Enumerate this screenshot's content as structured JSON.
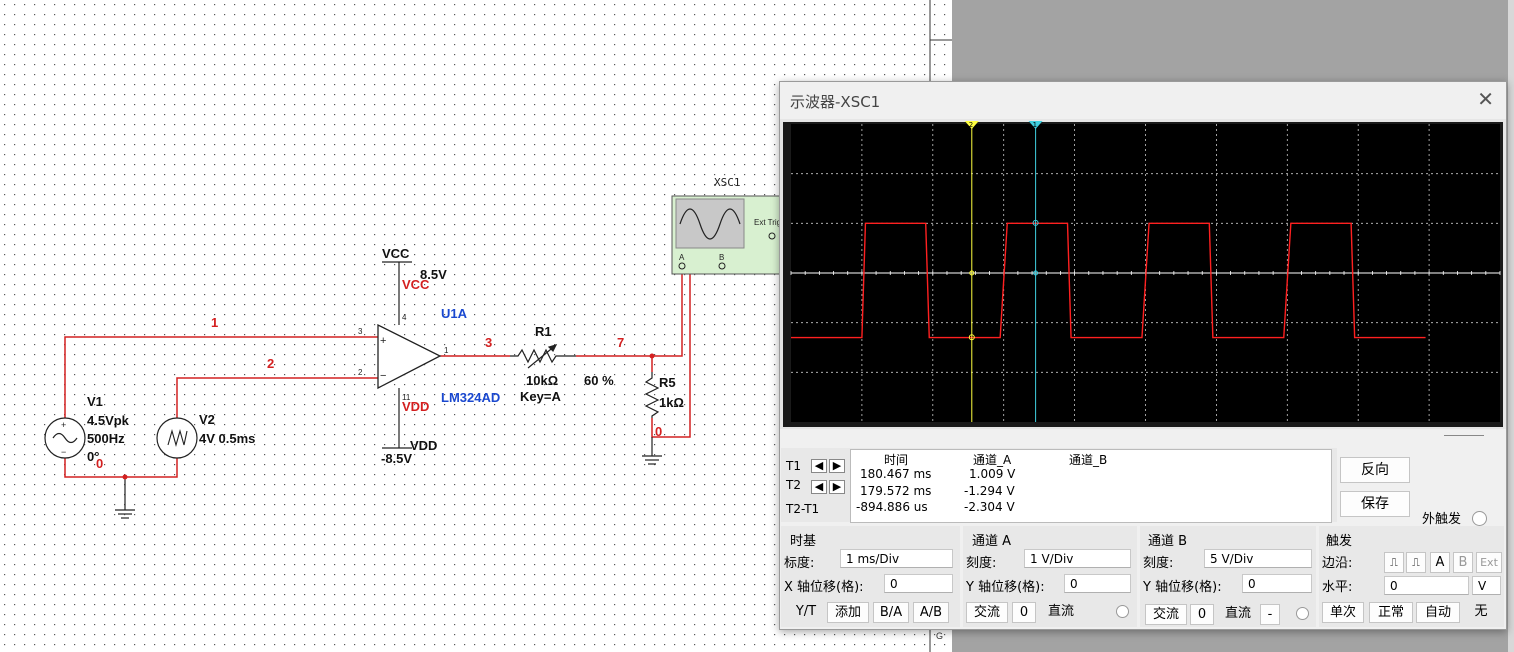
{
  "schematic": {
    "vcc_label": "VCC",
    "vcc_value": "8.5V",
    "vcc_net": "VCC",
    "vdd_label": "VDD",
    "vdd_value": "-8.5V",
    "vdd_net": "VDD",
    "opamp_ref": "U1A",
    "opamp_part": "LM324AD",
    "pin_plus": "3",
    "pin_minus": "2",
    "pin_out": "1",
    "pin_vcc": "4",
    "pin_vdd": "11",
    "plus_sign": "+",
    "minus_sign": "−",
    "net1": "1",
    "net2": "2",
    "net3": "3",
    "net7": "7",
    "net0a": "0",
    "net0b": "0",
    "v1_name": "V1",
    "v1_amp": "4.5Vpk",
    "v1_freq": "500Hz",
    "v1_phase": "0°",
    "v2_name": "V2",
    "v2_value": "4V 0.5ms",
    "r1_name": "R1",
    "r1_value": "10kΩ",
    "r1_key": "Key=A",
    "r1_percent": "60 %",
    "r5_name": "R5",
    "r5_value": "1kΩ",
    "xsc_name": "XSC1",
    "xsc_ext": "Ext Trig",
    "xsc_a": "A",
    "xsc_b": "B",
    "margin_g": "G"
  },
  "oscilloscope": {
    "title": "示波器-XSC1",
    "close_icon": "close-icon",
    "readout": {
      "col_time": "时间",
      "col_a": "通道_A",
      "col_b": "通道_B",
      "rows": [
        {
          "label": "T1",
          "time": "180.467 ms",
          "a": "1.009 V",
          "b": ""
        },
        {
          "label": "T2",
          "time": "179.572 ms",
          "a": "-1.294 V",
          "b": ""
        },
        {
          "label": "T2-T1",
          "time": "-894.886 us",
          "a": "-2.304 V",
          "b": ""
        }
      ]
    },
    "reverse_label": "反向",
    "save_label": "保存",
    "ext_trigger_label": "外触发",
    "timebase": {
      "title": "时基",
      "scale_label": "标度:",
      "scale_value": "1 ms/Div",
      "xpos_label": "X 轴位移(格):",
      "xpos_value": "0",
      "buttons": [
        "Y/T",
        "添加",
        "B/A",
        "A/B"
      ]
    },
    "channel_a": {
      "title": "通道 A",
      "scale_label": "刻度:",
      "scale_value": "1  V/Div",
      "ypos_label": "Y 轴位移(格):",
      "ypos_value": "0",
      "ac_label": "交流",
      "zero_label": "0",
      "dc_label": "直流"
    },
    "channel_b": {
      "title": "通道 B",
      "scale_label": "刻度:",
      "scale_value": "5  V/Div",
      "ypos_label": "Y 轴位移(格):",
      "ypos_value": "0",
      "ac_label": "交流",
      "zero_label": "0",
      "dc_label": "直流",
      "minus_label": "-"
    },
    "trigger": {
      "title": "触发",
      "edge_label": "边沿:",
      "edge_buttons": [
        "A",
        "B",
        "Ext"
      ],
      "level_label": "水平:",
      "level_value": "0",
      "level_unit": "V",
      "mode_buttons": [
        "单次",
        "正常",
        "自动",
        "无"
      ]
    },
    "cursor1_tag": "1",
    "cursor2_tag": "2",
    "colors": {
      "screen": "#000000",
      "grid": "#c8c8c8",
      "trace_a": "#ff2020",
      "cursor1": "#ffff40",
      "cursor2": "#40d0e0"
    },
    "chart_data": {
      "type": "line",
      "ylabel": "",
      "xlabel": "",
      "grid": true,
      "divisions": {
        "x": 10,
        "y": 6
      },
      "x_units": "ms",
      "y_units": "V",
      "xlim": [
        0,
        10
      ],
      "ylim": [
        -3,
        3
      ],
      "series": [
        {
          "x": [
            0,
            1.0,
            1.05,
            1.35,
            1.9,
            1.95,
            2.95,
            3.05,
            3.35,
            3.9,
            3.95,
            4.95,
            5.05,
            5.35,
            5.9,
            5.95,
            6.95,
            7.05,
            7.35,
            7.9,
            7.95,
            8.95
          ],
          "y": [
            -1.3,
            -1.3,
            1.0,
            1.0,
            1.0,
            -1.3,
            -1.3,
            1.0,
            1.0,
            1.0,
            -1.3,
            -1.3,
            1.0,
            1.0,
            1.0,
            -1.3,
            -1.3,
            1.0,
            1.0,
            1.0,
            -1.3,
            -1.3
          ]
        }
      ],
      "cursors": {
        "t1_x": 2.55,
        "t2_x": 3.45
      }
    }
  }
}
